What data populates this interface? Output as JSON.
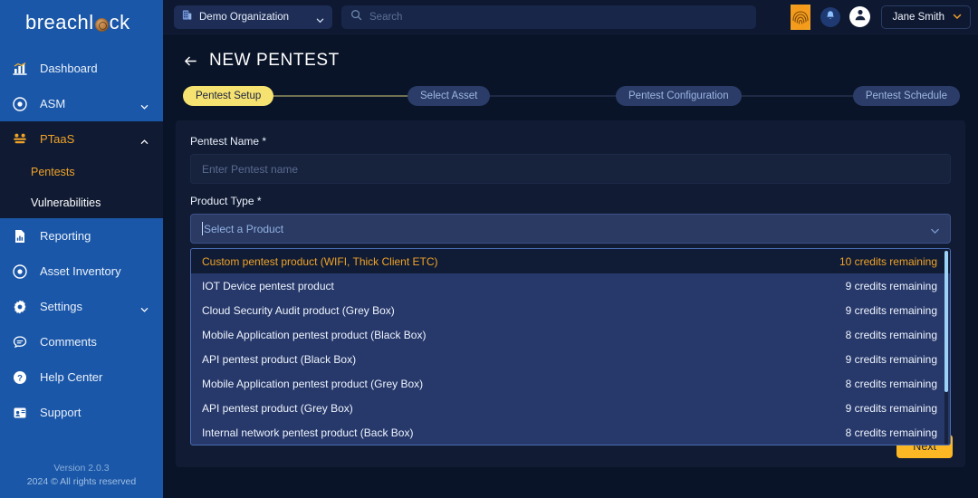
{
  "brand": {
    "name": "breachlock",
    "accent": "#f0a227",
    "sidebar_bg": "#1b57a8"
  },
  "sidebar": {
    "items": [
      {
        "label": "Dashboard",
        "icon": "chart-bar-icon",
        "expandable": false
      },
      {
        "label": "ASM",
        "icon": "target-icon",
        "expandable": true
      },
      {
        "label": "PTaaS",
        "icon": "users-group-icon",
        "expandable": true,
        "expanded": true,
        "active": true
      },
      {
        "label": "Reporting",
        "icon": "report-document-icon",
        "expandable": false
      },
      {
        "label": "Asset Inventory",
        "icon": "target-icon",
        "expandable": false
      },
      {
        "label": "Settings",
        "icon": "gear-icon",
        "expandable": true
      },
      {
        "label": "Comments",
        "icon": "chat-bubble-icon",
        "expandable": false
      },
      {
        "label": "Help Center",
        "icon": "question-circle-icon",
        "expandable": false
      },
      {
        "label": "Support",
        "icon": "support-headset-icon",
        "expandable": false
      }
    ],
    "ptaas_children": [
      {
        "label": "Pentests",
        "active": true
      },
      {
        "label": "Vulnerabilities",
        "active": false
      }
    ],
    "footer": {
      "version": "Version 2.0.3",
      "copyright": "2024 © All rights reserved"
    }
  },
  "topbar": {
    "org": {
      "label": "Demo Organization",
      "icon": "building-icon",
      "chevron": "chevron-down-icon"
    },
    "search": {
      "value": "",
      "placeholder": "Search",
      "icon": "search-icon"
    },
    "fingerprint_icon": "fingerprint-scan-icon",
    "notifications_icon": "bell-icon",
    "avatar_icon": "user-avatar-icon",
    "user": {
      "name": "Jane Smith",
      "chevron": "chevron-down-icon"
    }
  },
  "page": {
    "back_icon": "arrow-left-icon",
    "title": "NEW PENTEST"
  },
  "stepper": {
    "steps": [
      {
        "label": "Pentest Setup",
        "state": "active"
      },
      {
        "label": "Select Asset",
        "state": "idle"
      },
      {
        "label": "Pentest Configuration",
        "state": "idle"
      },
      {
        "label": "Pentest Schedule",
        "state": "idle"
      }
    ],
    "active_line_color": "#d6d07a",
    "idle_line_color": "#334061"
  },
  "form": {
    "pentest_name": {
      "label": "Pentest Name *",
      "value": "",
      "placeholder": "Enter Pentest name"
    },
    "product_type": {
      "label": "Product Type *",
      "value": "",
      "placeholder": "Select a Product",
      "chevron": "chevron-down-icon",
      "open": true,
      "options": [
        {
          "label": "Custom pentest product (WIFI, Thick Client ETC)",
          "credits": "10 credits remaining",
          "highlighted": true
        },
        {
          "label": "IOT Device pentest product",
          "credits": "9 credits remaining",
          "highlighted": false
        },
        {
          "label": "Cloud Security Audit product (Grey Box)",
          "credits": "9 credits remaining",
          "highlighted": false
        },
        {
          "label": "Mobile Application pentest product (Black Box)",
          "credits": "8 credits remaining",
          "highlighted": false
        },
        {
          "label": "API pentest product (Black Box)",
          "credits": "9 credits remaining",
          "highlighted": false
        },
        {
          "label": "Mobile Application pentest product (Grey Box)",
          "credits": "8 credits remaining",
          "highlighted": false
        },
        {
          "label": "API pentest product (Grey Box)",
          "credits": "9 credits remaining",
          "highlighted": false
        },
        {
          "label": "Internal network pentest product (Back Box)",
          "credits": "8 credits remaining",
          "highlighted": false
        }
      ]
    },
    "next_button": {
      "label": "Next",
      "color": "#fcb725"
    }
  }
}
